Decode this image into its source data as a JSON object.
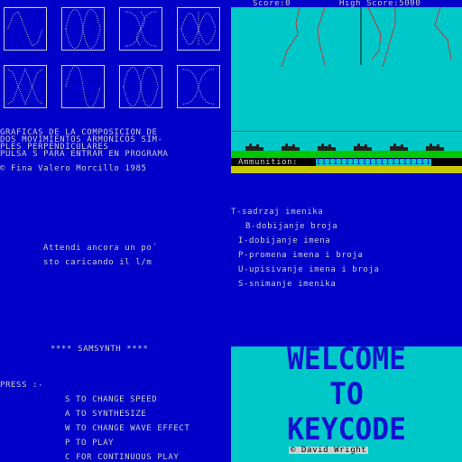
{
  "colors": {
    "screen_blue": "#0000c8",
    "cyan": "#00c8c8",
    "text_light": "#cfcfcf",
    "lightning_red": "#b43c3c",
    "ground_green": "#00c800",
    "ammo_bar_yellow": "#c8c800",
    "ammo_bar_blue": "#0000ff"
  },
  "lissajous_panel": {
    "text_lines": [
      "GRAFICAS DE LA COMPOSICION DE",
      "DOS MOVIMIENTOS ARMONICOS SIM-",
      "PLES PERPENDICULARES",
      "PULSA S PARA ENTRAR EN PROGRAMA"
    ],
    "copyright": "© Fina Valero Morcillo 1985"
  },
  "shooter_panel": {
    "score_label": "Score:0",
    "high_score_label": "High Score:5000",
    "ammunition_label": "Ammunition:",
    "ammunition_bar": "IIIIIIIIIIIIIIIIIIII"
  },
  "loading_panel": {
    "line1": "Attendi ancora un po´",
    "line2": "sto caricando il l/m"
  },
  "menu_panel": {
    "items": [
      "T-sadrzaj imenika",
      "B-dobijanje broja",
      "I-dobijanje imena",
      "P-promena imena i broja",
      "U-upisivanje imena i broja",
      "S-snimanje imenika"
    ]
  },
  "samsynth_panel": {
    "title": "**** SAMSYNTH ****",
    "press_label": "PRESS :-",
    "options": [
      "S TO CHANGE SPEED",
      "A TO SYNTHESIZE",
      "W TO CHANGE WAVE EFFECT",
      "P TO PLAY",
      "C FOR CONTINUOUS PLAY"
    ]
  },
  "keycode_panel": {
    "line1": "WELCOME",
    "line2": "TO",
    "line3": "KEYCODE",
    "credit": "© David Wright"
  }
}
